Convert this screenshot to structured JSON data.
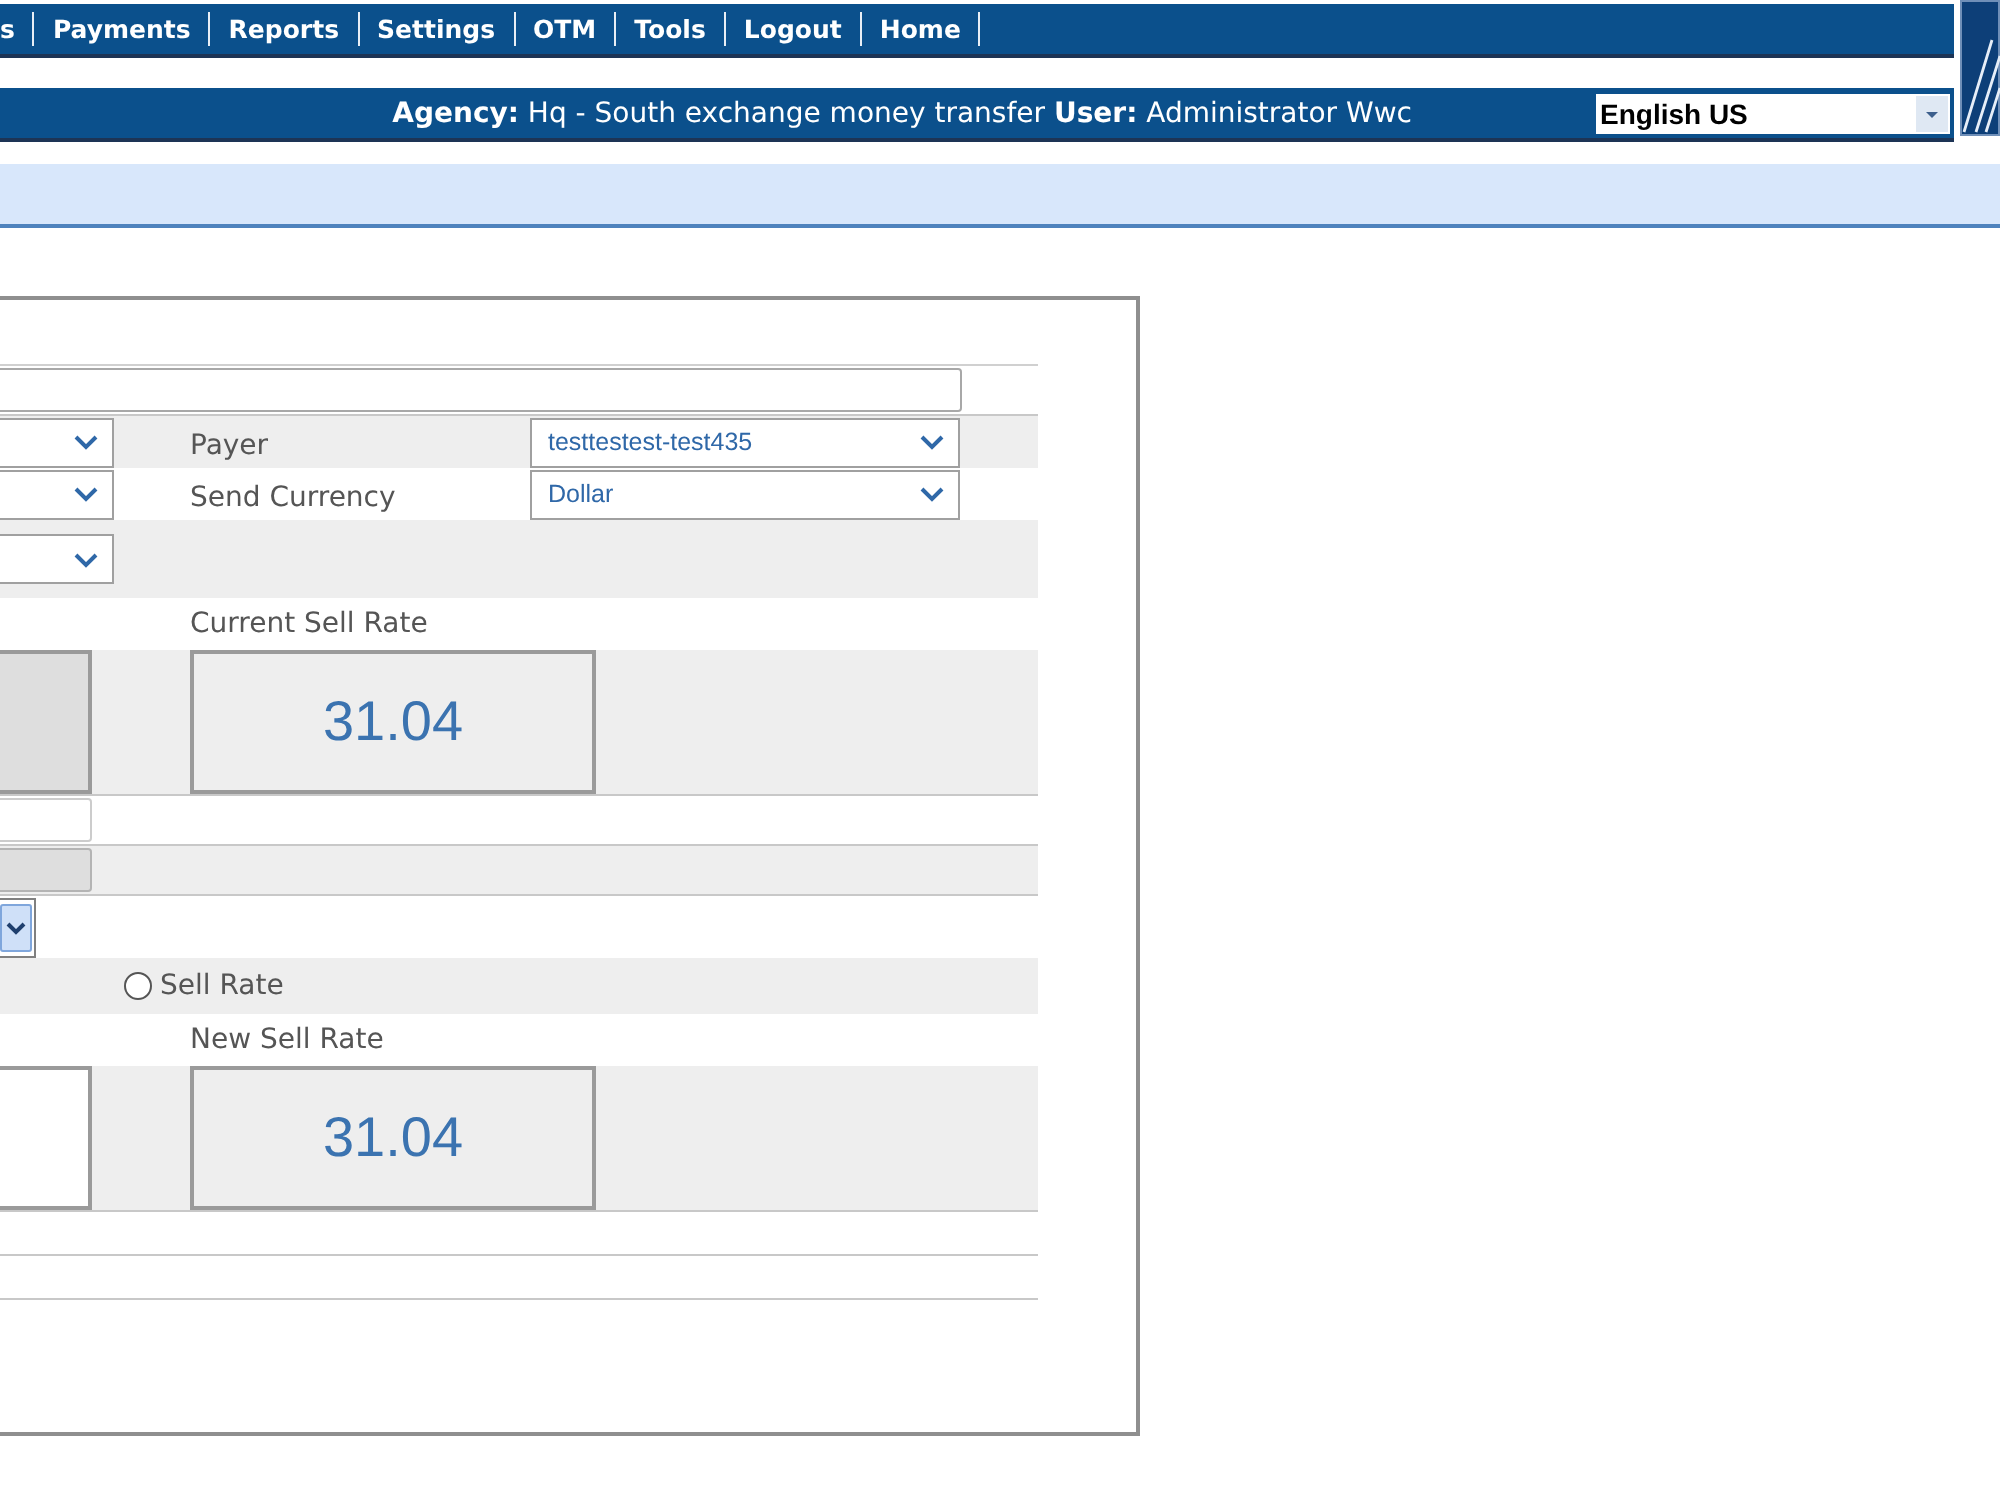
{
  "nav_menu": {
    "items": [
      "s",
      "Payments",
      "Reports",
      "Settings",
      "OTM",
      "Tools",
      "Logout",
      "Home"
    ]
  },
  "info_bar": {
    "text": "**Agency:** Hq - South exchange money transfer **User:** Administrator Wwc"
  },
  "language_select": {
    "value": "English US"
  },
  "form": {
    "rows": [
      {
        "kind": "text_input"
      },
      {
        "kind": "select_pair",
        "label": "Payer",
        "value": "testtestest-test435"
      },
      {
        "kind": "select_pair",
        "label": "Send Currency",
        "value": "Dollar"
      },
      {
        "kind": "select_only"
      },
      {
        "kind": "caption",
        "label": "Current Sell Rate"
      },
      {
        "kind": "rate",
        "left_field_disabled": true,
        "value": "31.04"
      },
      {
        "kind": "short_input",
        "disabled": false
      },
      {
        "kind": "short_input",
        "disabled": true
      },
      {
        "kind": "small_select",
        "focused": true
      },
      {
        "kind": "radio",
        "label": "Sell Rate",
        "selected": false
      },
      {
        "kind": "caption",
        "label": "New Sell Rate"
      },
      {
        "kind": "rate",
        "left_field_disabled": false,
        "value": "31.04"
      },
      {
        "kind": "blank"
      },
      {
        "kind": "blank"
      }
    ]
  }
}
